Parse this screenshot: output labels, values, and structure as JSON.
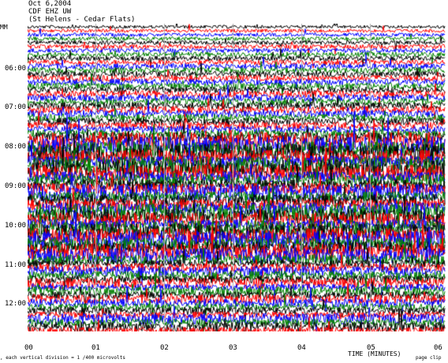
{
  "header": {
    "date": "Oct 6,2004",
    "station": "CDF EHZ UW",
    "location": "(St Helens - Cedar Flats)"
  },
  "y_axis": {
    "labels": [
      "06:00",
      "07:00",
      "08:00",
      "09:00",
      "10:00",
      "11:00",
      "12:00"
    ],
    "top_label": "MM"
  },
  "x_axis": {
    "labels": [
      "00",
      "01",
      "02",
      "03",
      "04",
      "05",
      "06"
    ],
    "title": "TIME (MINUTES)"
  },
  "footer": {
    "left": ", each vertical division = 1 /400 microvolts",
    "right": "page clip"
  },
  "trace_colors": [
    "#000000",
    "#ff0000",
    "#0000ff",
    "#008000"
  ]
}
